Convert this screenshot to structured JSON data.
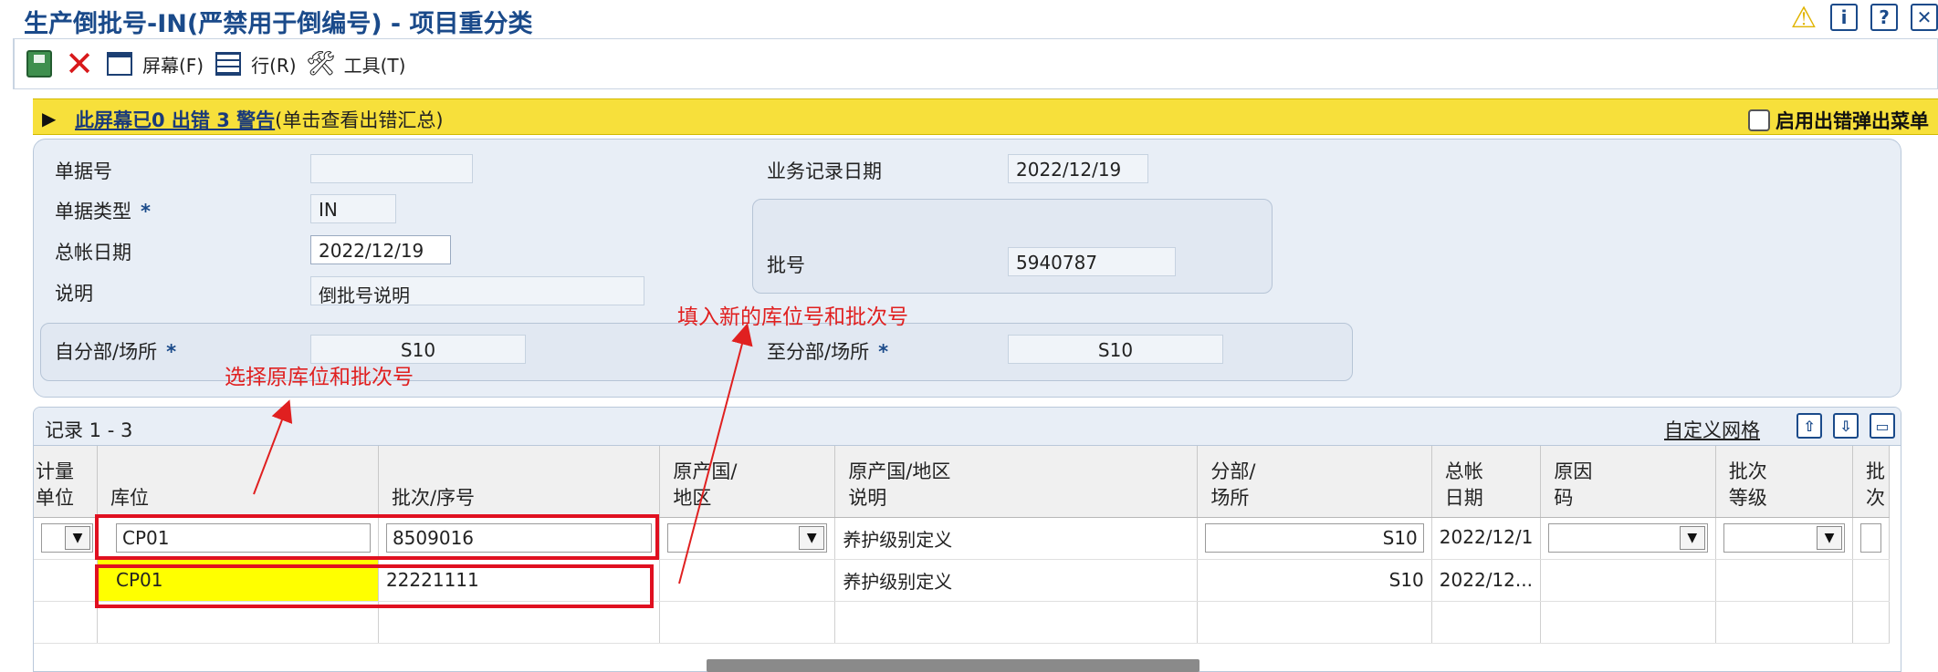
{
  "window": {
    "title": "生产倒批号-IN(严禁用于倒编号) - 项目重分类",
    "icons": [
      "warning-icon",
      "info-icon",
      "help-icon",
      "close-icon"
    ]
  },
  "toolbar": {
    "screen_label": "屏幕(F)",
    "row_label": "行(R)",
    "tools_label": "工具(T)"
  },
  "banner": {
    "link_text": "此屏幕已0 出错 3 警告",
    "hint_text": "(单击查看出错汇总)",
    "popup_label": "启用出错弹出菜单"
  },
  "form": {
    "doc_no_label": "单据号",
    "doc_no_value": "",
    "doc_type_label": "单据类型",
    "doc_type_value": "IN",
    "gl_date_label": "总帐日期",
    "gl_date_value": "2022/12/19",
    "desc_label": "说明",
    "desc_value": "倒批号说明",
    "trans_date_label": "业务记录日期",
    "trans_date_value": "2022/12/19",
    "batch_label": "批号",
    "batch_value": "5940787",
    "from_branch_label": "自分部/场所",
    "from_branch_value": "S10",
    "to_branch_label": "至分部/场所",
    "to_branch_value": "S10"
  },
  "annotations": {
    "select_original": "选择原库位和批次号",
    "fill_new": "填入新的库位号和批次号"
  },
  "grid": {
    "records": "记录 1 - 3",
    "custom_grid": "自定义网格",
    "columns": [
      "计量\n单位",
      "库位",
      "批次/序号",
      "原产国/\n地区",
      "原产国/地区\n说明",
      "分部/\n场所",
      "总帐\n日期",
      "原因\n码",
      "批次\n等级",
      "批\n次"
    ],
    "rows": [
      {
        "location": "CP01",
        "lot": "8509016",
        "country_desc": "养护级别定义",
        "branch": "S10",
        "gl_date": "2022/12/1"
      },
      {
        "location": "CP01",
        "lot": "22221111",
        "country_desc": "养护级别定义",
        "branch": "S10",
        "gl_date": "2022/12..."
      }
    ]
  },
  "colors": {
    "title": "#1a4a8a",
    "banner": "#f7e03b",
    "annotation": "#e02020",
    "highlight": "#ffff00"
  }
}
